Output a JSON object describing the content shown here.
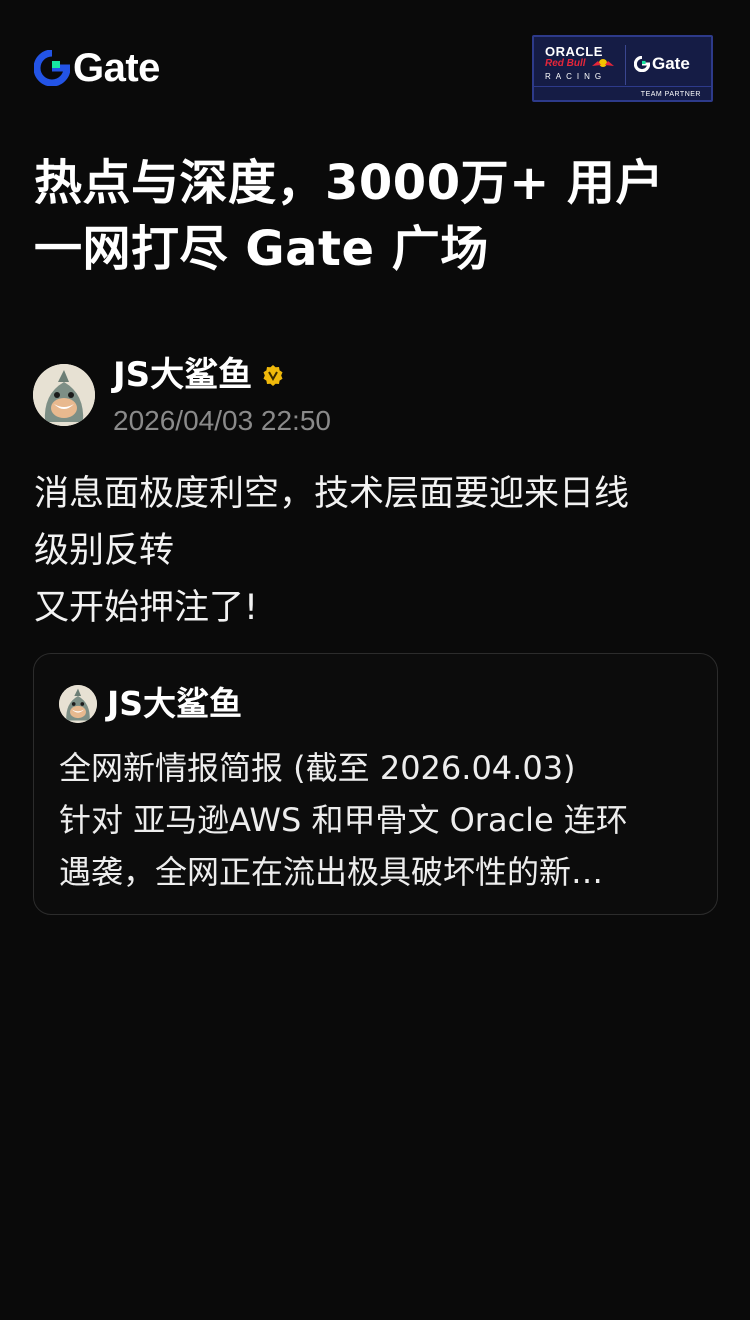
{
  "header": {
    "logo_text": "Gate",
    "partner": {
      "oracle": "ORACLE",
      "redbull": "Red Bull",
      "racing": "RACING",
      "gate": "Gate",
      "team_partner": "TEAM PARTNER"
    }
  },
  "headline": {
    "line1": "热点与深度，3000万+ 用户",
    "line2": "一网打尽 Gate 广场"
  },
  "post": {
    "author": "JS大鲨鱼",
    "verified_icon": "verified-badge-icon",
    "time": "2026/04/03 22:50",
    "body": [
      "消息面极度利空，技术层面要迎来日线",
      "级别反转",
      "又开始押注了!"
    ]
  },
  "quote": {
    "author": "JS大鲨鱼",
    "lines": [
      "全网新情报简报 (截至 2026.04.03)",
      "针对 亚马逊AWS 和甲骨文 Oracle 连环",
      "遇袭，全网正在流出极具破坏性的新…"
    ]
  },
  "colors": {
    "background": "#0a0a0a",
    "brand_blue": "#2354e6",
    "brand_green": "#17e6a1",
    "verified_gold": "#f0b90b",
    "muted_text": "#8a8a8a"
  }
}
